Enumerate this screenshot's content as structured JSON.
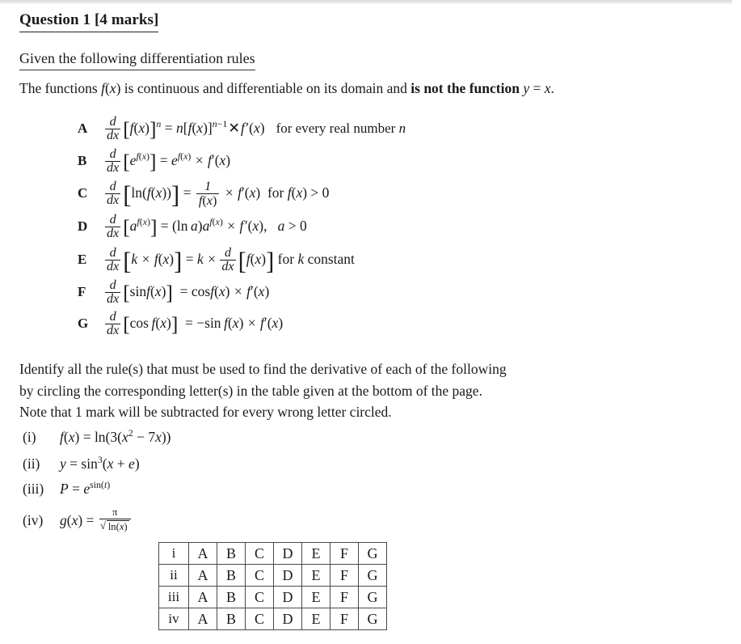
{
  "document": {
    "title": "Question 1 [4 marks]",
    "title_prefix": "Question 1",
    "title_marks": "[4 marks]",
    "subheading": "Given the following differentiation rules",
    "intro_plain_1": "The functions ",
    "intro_fx": "f(x)",
    "intro_plain_2": " is continuous and differentiable on its domain and ",
    "intro_bold": "is not the function",
    "intro_tail_y": "y",
    "intro_tail_eq": " = ",
    "intro_tail_x": "x",
    "intro_tail_period": "."
  },
  "rules": [
    {
      "letter": "A",
      "lhs": "d/dx [f(x)]^n",
      "rhs": "n[f(x)]^(n-1) × f'(x)",
      "note": "for every real number n",
      "note_var": "n"
    },
    {
      "letter": "B",
      "lhs": "d/dx [e^f(x)]",
      "rhs": "e^f(x) × f'(x)",
      "note": ""
    },
    {
      "letter": "C",
      "lhs": "d/dx [ln(f(x))]",
      "rhs": "1/f(x) × f'(x)",
      "note": "for f(x) > 0"
    },
    {
      "letter": "D",
      "lhs": "d/dx [a^f(x)]",
      "rhs": "(ln a)a^f(x) × f'(x),",
      "note": "a > 0"
    },
    {
      "letter": "E",
      "lhs": "d/dx [k × f(x)]",
      "rhs": "k × d/dx [f(x)]",
      "note": "for k constant"
    },
    {
      "letter": "F",
      "lhs": "d/dx [sin f(x)]",
      "rhs": "cos f(x) × f'(x)",
      "note": ""
    },
    {
      "letter": "G",
      "lhs": "d/dx [cos f(x)]",
      "rhs": "− sin f(x) × f'(x)",
      "note": ""
    }
  ],
  "instructions": {
    "line1": "Identify all the rule(s) that must be used to find the derivative of each of the following",
    "line2": "by circling the corresponding letter(s) in the table given at the bottom of the page.",
    "line3": "Note that 1 mark will be subtracted for every wrong letter circled."
  },
  "subquestions": [
    {
      "label": "(i)",
      "expression": "f(x) = ln(3(x² − 7x))"
    },
    {
      "label": "(ii)",
      "expression": "y = sin³(x + e)"
    },
    {
      "label": "(iii)",
      "expression": "P = e^sin(t)"
    },
    {
      "label": "(iv)",
      "expression": "g(x) = π / √(ln(x))"
    }
  ],
  "answer_table": {
    "row_labels": [
      "i",
      "ii",
      "iii",
      "iv"
    ],
    "options": [
      "A",
      "B",
      "C",
      "D",
      "E",
      "F",
      "G"
    ],
    "rows": [
      {
        "label": "i",
        "cells": [
          "A",
          "B",
          "C",
          "D",
          "E",
          "F",
          "G"
        ]
      },
      {
        "label": "ii",
        "cells": [
          "A",
          "B",
          "C",
          "D",
          "E",
          "F",
          "G"
        ]
      },
      {
        "label": "iii",
        "cells": [
          "A",
          "B",
          "C",
          "D",
          "E",
          "F",
          "G"
        ]
      },
      {
        "label": "iv",
        "cells": [
          "A",
          "B",
          "C",
          "D",
          "E",
          "F",
          "G"
        ]
      }
    ]
  },
  "colors": {
    "background": "#ffffff",
    "text": "#1a1a1a",
    "rule_line": "#333333",
    "table_border": "#4a4a4a",
    "top_band": "#e2e2e2"
  }
}
